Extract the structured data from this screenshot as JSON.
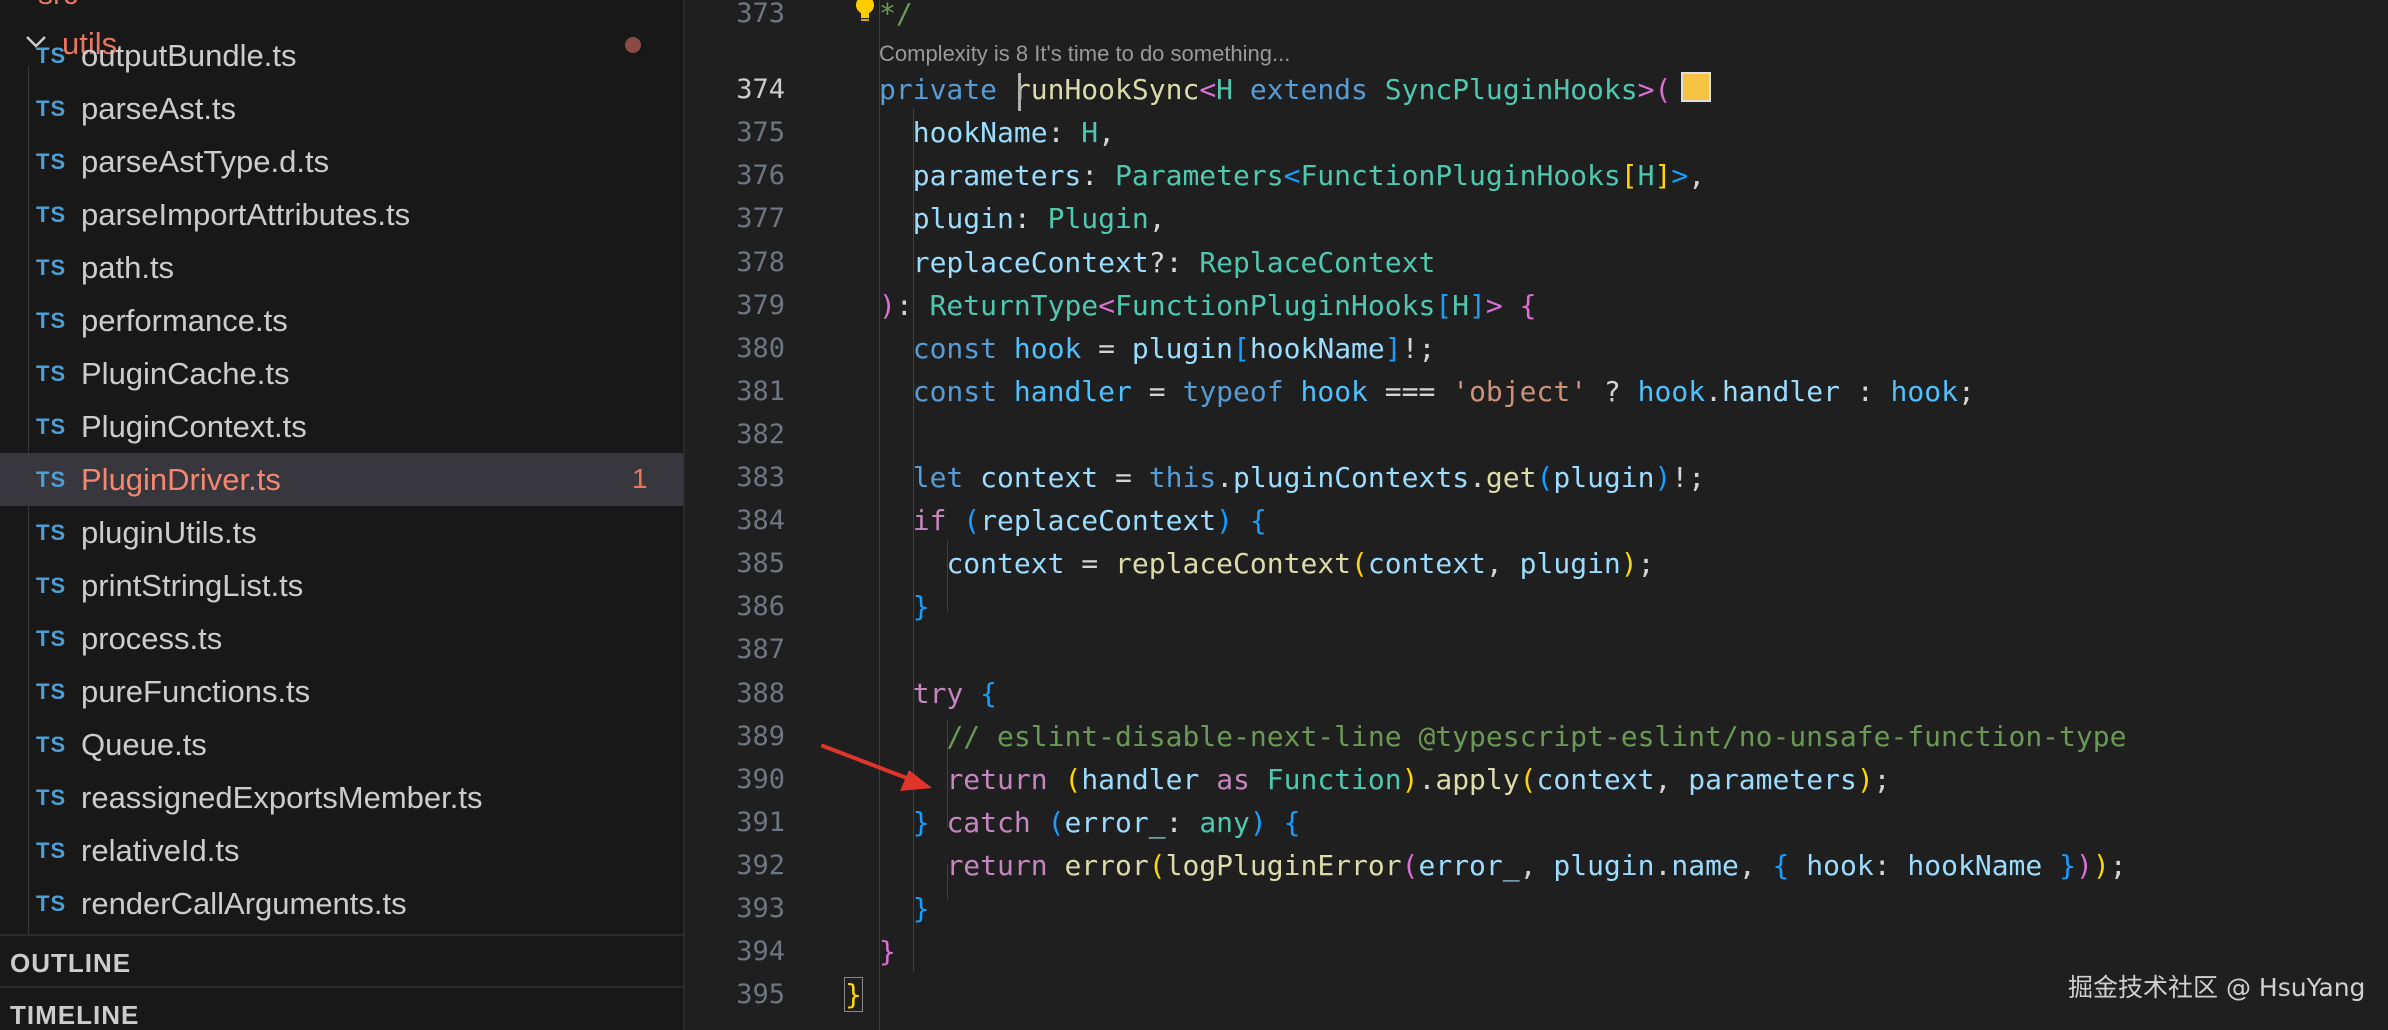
{
  "sidebar": {
    "partial_top_label": "src",
    "folder": {
      "name": "utils",
      "expanded": true,
      "has_modified_dot": true
    },
    "file_type_label": "TS",
    "files": [
      {
        "name": "outputBundle.ts"
      },
      {
        "name": "parseAst.ts"
      },
      {
        "name": "parseAstType.d.ts"
      },
      {
        "name": "parseImportAttributes.ts"
      },
      {
        "name": "path.ts"
      },
      {
        "name": "performance.ts"
      },
      {
        "name": "PluginCache.ts"
      },
      {
        "name": "PluginContext.ts"
      },
      {
        "name": "PluginDriver.ts",
        "active": true,
        "badge": "1"
      },
      {
        "name": "pluginUtils.ts"
      },
      {
        "name": "printStringList.ts"
      },
      {
        "name": "process.ts"
      },
      {
        "name": "pureFunctions.ts"
      },
      {
        "name": "Queue.ts"
      },
      {
        "name": "reassignedExportsMember.ts"
      },
      {
        "name": "relativeId.ts"
      },
      {
        "name": "renderCallArguments.ts"
      }
    ],
    "panels": {
      "outline": "OUTLINE",
      "timeline": "TIMELINE"
    }
  },
  "editor": {
    "codelens": "Complexity is 8 It's time to do something...",
    "current_line": 374,
    "line_numbers": [
      "373",
      "374",
      "375",
      "376",
      "377",
      "378",
      "379",
      "380",
      "381",
      "382",
      "383",
      "384",
      "385",
      "386",
      "387",
      "388",
      "389",
      "390",
      "391",
      "392",
      "393",
      "394",
      "395"
    ],
    "annotation_arrow_points_to_line": 390,
    "colors": {
      "background": "#1f1f1f",
      "sidebar": "#181818",
      "accent": "#e8765f",
      "arrow": "#e0352b"
    }
  },
  "watermark": "掘金技术社区 @ HsuYang"
}
